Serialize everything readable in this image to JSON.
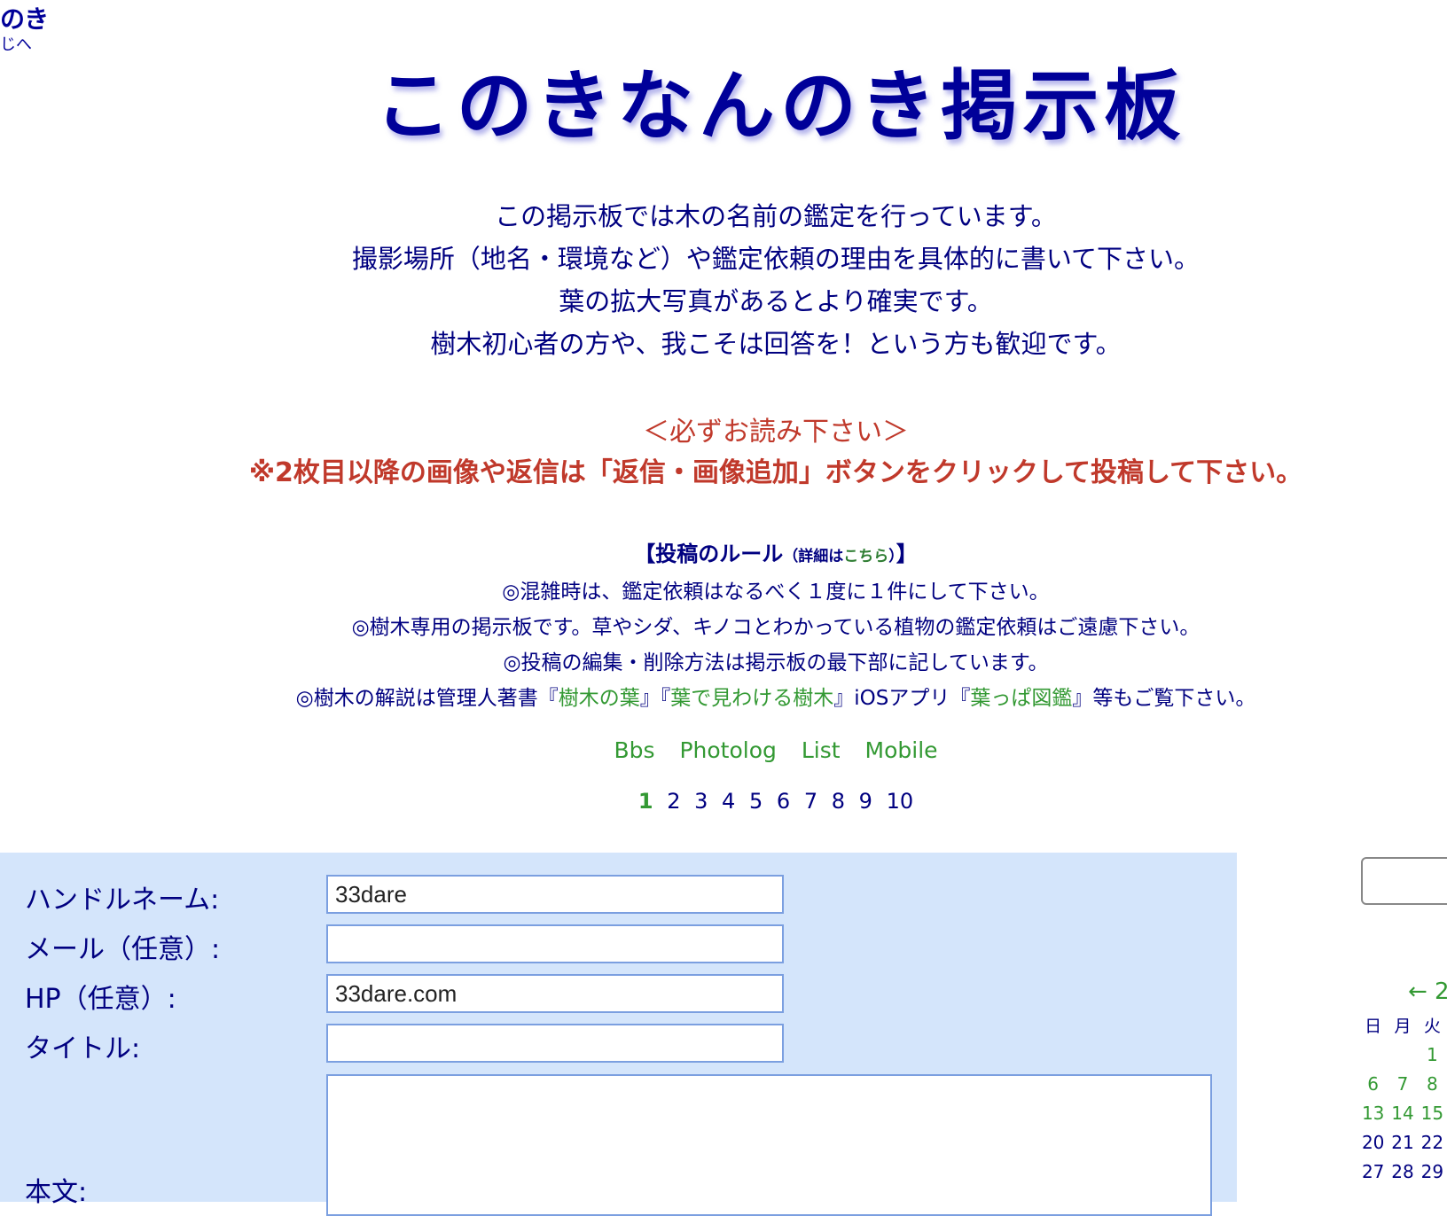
{
  "corner": {
    "line1": "のき",
    "line2": "じへ"
  },
  "logo": {
    "text": "このきなんのき掲示板"
  },
  "intro": [
    "この掲示板では木の名前の鑑定を行っています。",
    "撮影場所（地名・環境など）や鑑定依頼の理由を具体的に書いて下さい。",
    "葉の拡大写真があるとより確実です。",
    "樹木初心者の方や、我こそは回答を！という方も歓迎です。"
  ],
  "notice": {
    "heading": "＜必ずお読み下さい＞",
    "text": "※2枚目以降の画像や返信は「返信・画像追加」ボタンをクリックして投稿して下さい。"
  },
  "rules": {
    "title_open": "【投稿のルール",
    "detail_open": "（詳細は",
    "detail_link": "こちら",
    "detail_close": "）",
    "title_close": "】",
    "line1": "◎混雑時は、鑑定依頼はなるべく１度に１件にして下さい。",
    "line2": "◎樹木専用の掲示板です。草やシダ、キノコとわかっている植物の鑑定依頼はご遠慮下さい。",
    "line3": "◎投稿の編集・削除方法は掲示板の最下部に記しています。",
    "line4": {
      "p1": "◎樹木の解説は管理人著書『",
      "book1": "樹木の葉",
      "p2": "』『",
      "book2": "葉で見わける樹木",
      "p3": "』iOSアプリ『",
      "app": "葉っぱ図鑑",
      "p4": "』等もご覧下さい。"
    }
  },
  "nav": [
    "Bbs",
    "Photolog",
    "List",
    "Mobile"
  ],
  "pager": {
    "current": "1",
    "pages": [
      "2",
      "3",
      "4",
      "5",
      "6",
      "7",
      "8",
      "9",
      "10"
    ]
  },
  "form": {
    "handle_label": "ハンドルネーム:",
    "handle_value": "33dare",
    "mail_label": "メール（任意）:",
    "mail_value": "",
    "hp_label": "HP（任意）:",
    "hp_value": "33dare.com",
    "title_label": "タイトル:",
    "title_value": "",
    "body_label": "本文:"
  },
  "calendar": {
    "arrow": "← 2",
    "headers": [
      "日",
      "月",
      "火"
    ],
    "rows": [
      [
        "",
        "",
        "1"
      ],
      [
        "6",
        "7",
        "8"
      ],
      [
        "13",
        "14",
        "15"
      ],
      [
        "20",
        "21",
        "22"
      ],
      [
        "27",
        "28",
        "29"
      ]
    ]
  }
}
